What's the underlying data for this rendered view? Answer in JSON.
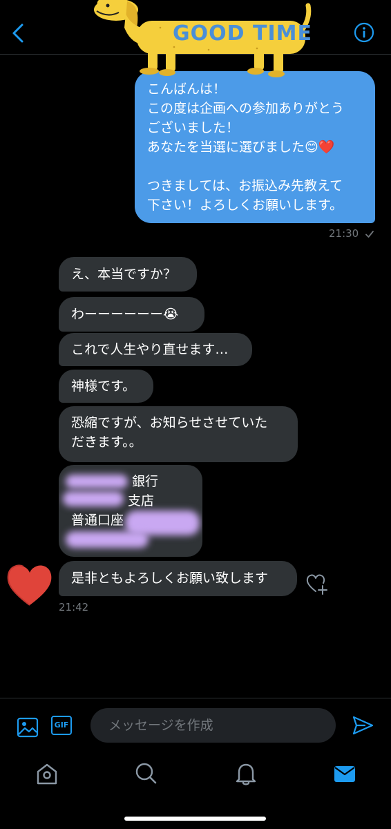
{
  "colors": {
    "accent": "#1d9bf0",
    "sent_bubble": "#4c9be8",
    "received_bubble": "#2f3336",
    "background": "#000000",
    "muted_text": "#71767b",
    "redaction": "#c9a8f2"
  },
  "header": {
    "back_icon": "chevron-left-icon",
    "info_icon": "info-icon",
    "avatar_text": "GOOD TIME"
  },
  "sent_message": {
    "lines": [
      "こんばんは！",
      "この度は企画への参加ありがとう",
      "ございました！",
      "あなたを当選に選びました",
      "",
      "つきましては、お振込み先教えて",
      "下さい！よろしくお願いします。"
    ],
    "emoji_smile": "😊",
    "emoji_heart": "❤️",
    "time": "21:30"
  },
  "received_messages": [
    {
      "lines": [
        "え、本当ですか？"
      ]
    },
    {
      "lines": [
        "わーーーーーー😭"
      ]
    },
    {
      "lines": [
        "これで人生やり直せます…"
      ]
    },
    {
      "lines": [
        "神様です。"
      ]
    },
    {
      "lines": [
        "恐縮ですが、お知らせさせていた",
        "だきます。。"
      ]
    },
    {
      "lines": [
        "銀行",
        "支店",
        "普通口座"
      ]
    },
    {
      "lines": [
        "是非ともよろしくお願い致します"
      ]
    }
  ],
  "received_time": "21:42",
  "composer": {
    "placeholder": "メッセージを作成",
    "gif_label": "GIF",
    "media_icon": "image-icon",
    "send_icon": "send-icon"
  },
  "bottom_nav": {
    "items": [
      "home-icon",
      "search-icon",
      "bell-icon",
      "mail-icon"
    ],
    "active": "mail-icon"
  }
}
